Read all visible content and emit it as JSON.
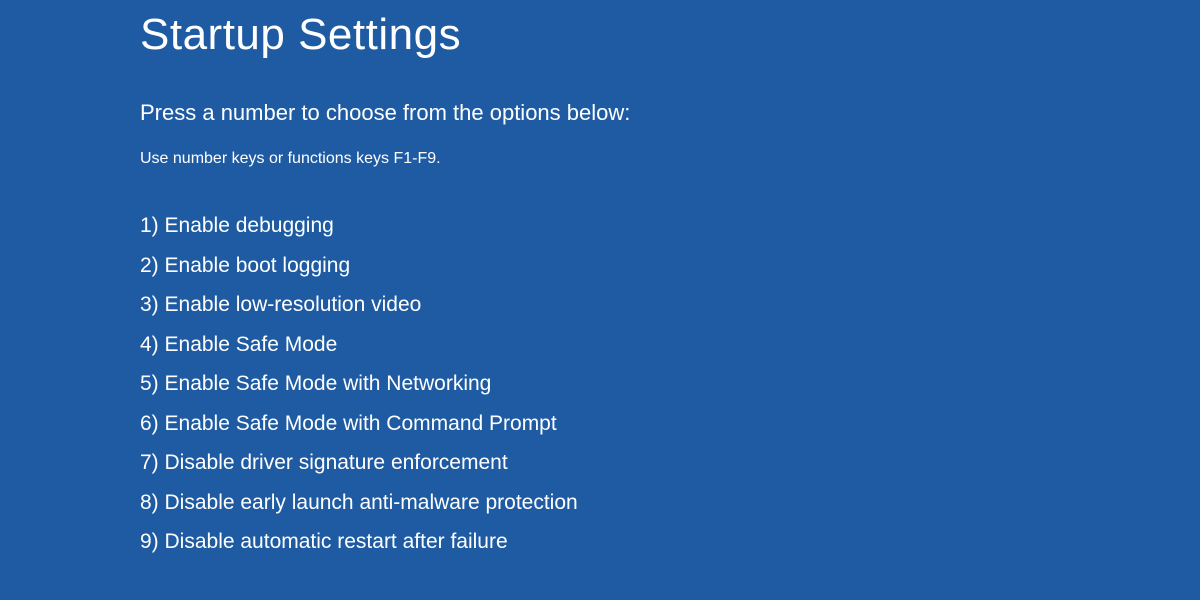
{
  "title": "Startup Settings",
  "instruction": "Press a number to choose from the options below:",
  "hint": "Use number keys or functions keys F1-F9.",
  "options": [
    "1) Enable debugging",
    "2) Enable boot logging",
    "3) Enable low-resolution video",
    "4) Enable Safe Mode",
    "5) Enable Safe Mode with Networking",
    "6) Enable Safe Mode with Command Prompt",
    "7) Disable driver signature enforcement",
    "8) Disable early launch anti-malware protection",
    "9) Disable automatic restart after failure"
  ]
}
